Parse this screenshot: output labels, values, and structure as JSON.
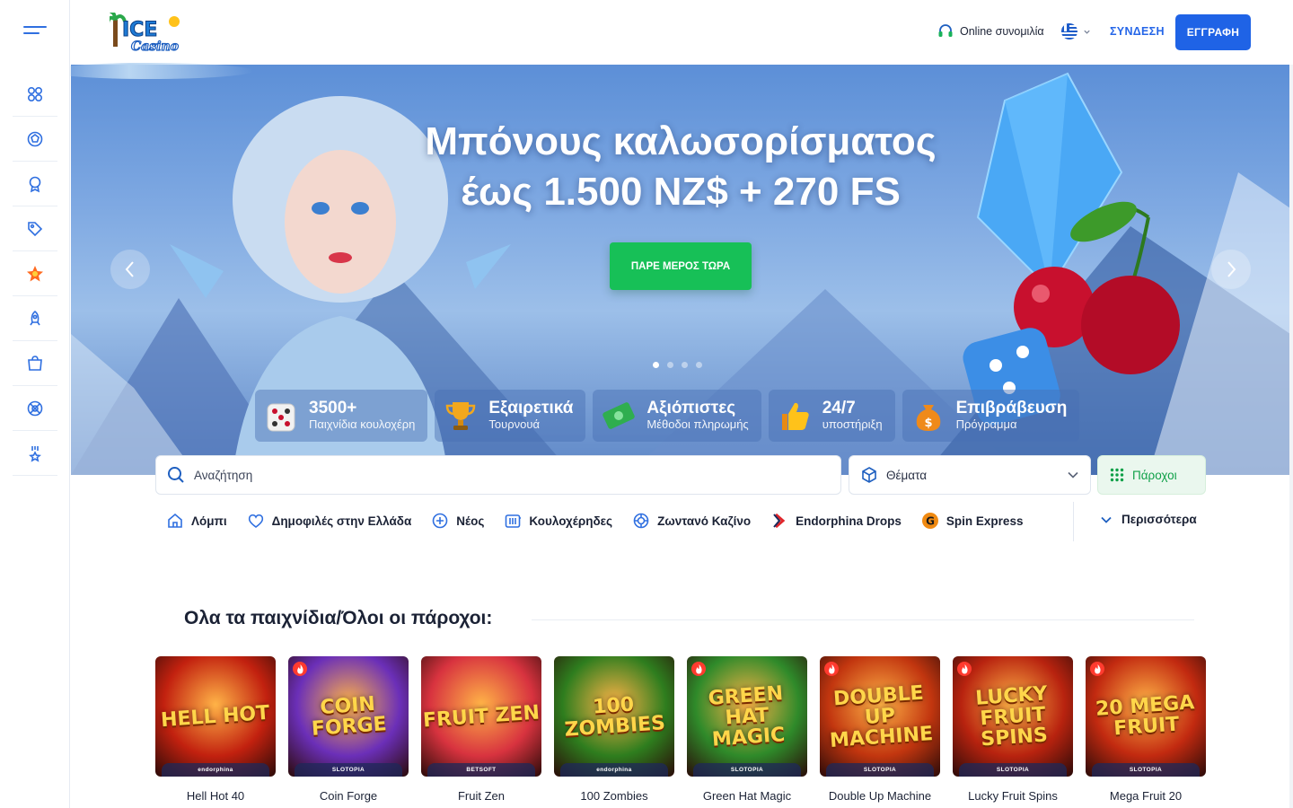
{
  "header": {
    "logo_text": "ICE Casino",
    "chat_label": "Online συνομιλία",
    "language_icon": "greece-flag-icon",
    "login_label": "ΣΥΝΔΕΣΗ",
    "register_label": "ΕΓΓΡΑΦΗ"
  },
  "sidebar": {
    "items": [
      {
        "icon": "grid-icon"
      },
      {
        "icon": "sports-ball-icon"
      },
      {
        "icon": "medal-icon"
      },
      {
        "icon": "tag-icon"
      },
      {
        "icon": "star-badge-icon"
      },
      {
        "icon": "rocket-icon"
      },
      {
        "icon": "shop-icon"
      },
      {
        "icon": "live-casino-icon"
      },
      {
        "icon": "trophy-star-icon"
      }
    ]
  },
  "hero": {
    "title_line1": "Μπόνους καλωσορίσματος",
    "title_line2": "έως 1.500 NZ$ + 270 FS",
    "cta_label": "ΠΑΡΕ ΜΕΡΟΣ ΤΩΡΑ",
    "slides_count": 4,
    "active_slide": 1,
    "features": [
      {
        "title": "3500+",
        "subtitle": "Παιχνίδια κουλοχέρη",
        "icon": "dice-icon"
      },
      {
        "title": "Εξαιρετικά",
        "subtitle": "Τουρνουά",
        "icon": "trophy-icon"
      },
      {
        "title": "Αξιόπιστες",
        "subtitle": "Μέθοδοι πληρωμής",
        "icon": "money-icon"
      },
      {
        "title": "24/7",
        "subtitle": "υποστήριξη",
        "icon": "thumbs-up-icon"
      },
      {
        "title": "Επιβράβευση",
        "subtitle": "Πρόγραμμα",
        "icon": "money-bag-icon"
      }
    ]
  },
  "filters": {
    "search_placeholder": "Αναζήτηση",
    "themes_label": "Θέματα",
    "providers_label": "Πάροχοι"
  },
  "categories": [
    {
      "label": "Λόμπι",
      "icon": "home-icon"
    },
    {
      "label": "Δημοφιλές στην Ελλάδα",
      "icon": "heart-icon"
    },
    {
      "label": "Νέος",
      "icon": "plus-circle-icon"
    },
    {
      "label": "Κουλοχέρηδες",
      "icon": "slots-icon"
    },
    {
      "label": "Ζωντανό Καζίνο",
      "icon": "chip-icon"
    },
    {
      "label": "Endorphina Drops",
      "icon": "endorphina-icon"
    },
    {
      "label": "Spin Express",
      "icon": "spin-express-icon"
    }
  ],
  "more_label": "Περισσότερα",
  "section_title": "Ολα τα παιχνίδια/Όλοι οι πάροχοι:",
  "games": [
    {
      "name": "Hell Hot 40",
      "art": "HELL HOT",
      "provider": "endorphina",
      "hot": false,
      "bg": "#c2210f"
    },
    {
      "name": "Coin Forge",
      "art": "COIN FORGE",
      "provider": "SLOTOPIA",
      "hot": true,
      "bg": "#6b2fb8"
    },
    {
      "name": "Fruit Zen",
      "art": "FRUIT ZEN",
      "provider": "BETSOFT",
      "hot": false,
      "bg": "#d8333f"
    },
    {
      "name": "100 Zombies",
      "art": "100 ZOMBIES",
      "provider": "endorphina",
      "hot": false,
      "bg": "#2e7d1e"
    },
    {
      "name": "Green Hat Magic",
      "art": "GREEN HAT MAGIC",
      "provider": "SLOTOPIA",
      "hot": true,
      "bg": "#2f8a2a"
    },
    {
      "name": "Double Up Machine",
      "art": "DOUBLE UP MACHINE",
      "provider": "SLOTOPIA",
      "hot": true,
      "bg": "#c2360f"
    },
    {
      "name": "Lucky Fruit Spins",
      "art": "LUCKY FRUIT SPINS",
      "provider": "SLOTOPIA",
      "hot": true,
      "bg": "#b8230f"
    },
    {
      "name": "Mega Fruit 20",
      "art": "20 MEGA FRUIT",
      "provider": "SLOTOPIA",
      "hot": true,
      "bg": "#c22a10"
    }
  ]
}
